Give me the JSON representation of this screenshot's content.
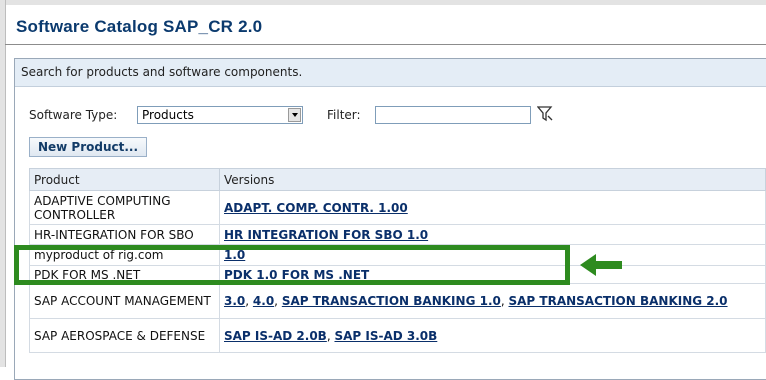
{
  "title": "Software Catalog SAP_CR 2.0",
  "panel": {
    "header": "Search for products and software components."
  },
  "filters": {
    "software_type_label": "Software Type:",
    "software_type_value": "Products",
    "filter_label": "Filter:",
    "filter_value": ""
  },
  "new_product_label": "New Product...",
  "table": {
    "columns": [
      "Product",
      "Versions"
    ],
    "rows": [
      {
        "product": "ADAPTIVE COMPUTING CONTROLLER",
        "versions": [
          "ADAPT. COMP. CONTR. 1.00"
        ]
      },
      {
        "product": "HR-INTEGRATION FOR SBO",
        "versions": [
          "HR INTEGRATION FOR SBO 1.0"
        ]
      },
      {
        "product": "myproduct of rig.com",
        "versions": [
          "1.0"
        ]
      },
      {
        "product": "PDK FOR MS .NET",
        "versions": [
          "PDK 1.0 FOR MS .NET"
        ]
      },
      {
        "product": "SAP ACCOUNT MANAGEMENT",
        "versions": [
          "3.0",
          "4.0",
          "SAP TRANSACTION BANKING 1.0",
          "SAP TRANSACTION BANKING 2.0"
        ]
      },
      {
        "product": "SAP AEROSPACE & DEFENSE",
        "versions": [
          "SAP IS-AD 2.0B",
          "SAP IS-AD 3.0B"
        ]
      }
    ]
  },
  "colors": {
    "title": "#0b3a6e",
    "highlight": "#2e8b1f",
    "link": "#0a2f6a"
  },
  "icons": {
    "filter": "funnel-icon",
    "dropdown": "chevron-down-icon",
    "annotation": "arrow-left-icon"
  }
}
